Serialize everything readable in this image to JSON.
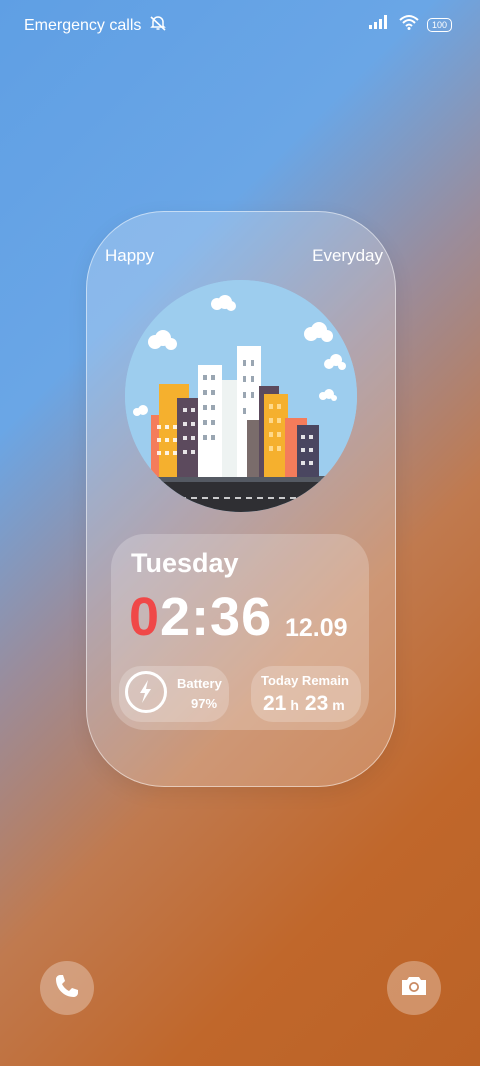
{
  "status_bar": {
    "carrier_text": "Emergency calls",
    "battery_level": "100",
    "icons": [
      "mute-bell-icon",
      "signal-icon",
      "wifi-icon",
      "battery-icon"
    ]
  },
  "widget": {
    "label_left": "Happy",
    "label_right": "Everyday",
    "day": "Tuesday",
    "time_first_digit": "0",
    "time_rest": "2:36",
    "date": "12.09",
    "battery_label": "Battery",
    "battery_value": "97%",
    "remain_label": "Today Remain",
    "remain_hours": "21",
    "remain_hours_unit": "h",
    "remain_minutes": "23",
    "remain_minutes_unit": "m",
    "accent_color": "#f04848"
  },
  "dock": {
    "left_icon": "phone-icon",
    "right_icon": "camera-icon"
  }
}
